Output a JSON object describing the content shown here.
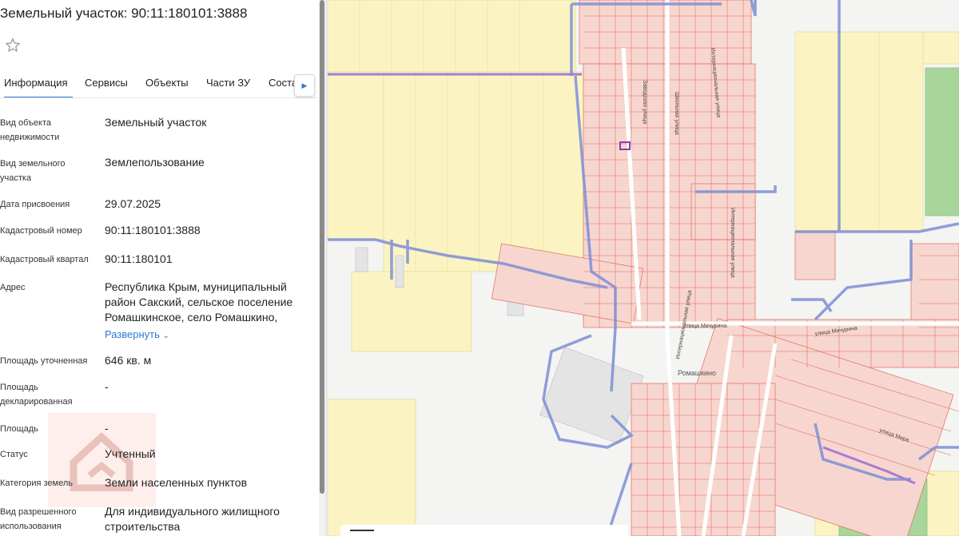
{
  "panel": {
    "title": "Земельный участок: 90:11:180101:3888",
    "tabs": [
      "Информация",
      "Сервисы",
      "Объекты",
      "Части ЗУ",
      "Соста"
    ],
    "rows": [
      {
        "label": "Вид объекта недвижимости",
        "value": "Земельный участок"
      },
      {
        "label": "Вид земельного участка",
        "value": "Землепользование"
      },
      {
        "label": "Дата присвоения",
        "value": "29.07.2025"
      },
      {
        "label": "Кадастровый номер",
        "value": "90:11:180101:3888"
      },
      {
        "label": "Кадастровый квартал",
        "value": "90:11:180101"
      },
      {
        "label": "Адрес",
        "value": "Республика Крым, муниципальный район Сакский, сельское поселение Ромашкинское, село Ромашкино,"
      },
      {
        "label": "Площадь уточненная",
        "value": "646 кв. м"
      },
      {
        "label": "Площадь декларированная",
        "value": "-"
      },
      {
        "label": "Площадь",
        "value": "-"
      },
      {
        "label": "Статус",
        "value": "Учтенный"
      },
      {
        "label": "Категория земель",
        "value": "Земли населенных пунктов"
      },
      {
        "label": "Вид разрешенного использования",
        "value": "Для индивидуального жилищного строительства"
      }
    ],
    "expand_label": "Развернуть"
  },
  "map": {
    "place_label": "Ромашкино",
    "streets": [
      "Улица Мичурина",
      "улица Мичурина",
      "улица Мира",
      "Интернациональная улица",
      "Интернациональная улица",
      "Интернациональная улица",
      "Заводская улица",
      "Школьная улица"
    ],
    "colors": {
      "field_yellow": "#fbf4c2",
      "parcel_fill": "#f7d6cf",
      "parcel_border": "#e06a5c",
      "boundary_blue": "#7d8fd6",
      "boundary_purple": "#a77bd4",
      "green_area": "#a9d49a",
      "accent": "#2a7bd6"
    }
  }
}
